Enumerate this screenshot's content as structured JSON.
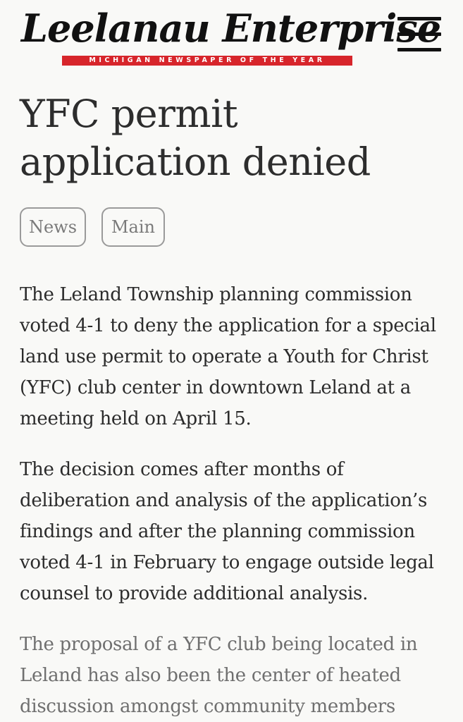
{
  "masthead": {
    "title": "Leelanau Enterprise",
    "tagline": "MICHIGAN NEWSPAPER OF THE YEAR",
    "menu_icon": "hamburger-menu-icon",
    "colors": {
      "tagline_bg": "#d7252b",
      "title": "#111111"
    }
  },
  "article": {
    "title_line1": "YFC permit",
    "title_line2": "application denied",
    "tags": [
      "News",
      "Main"
    ],
    "paragraphs": [
      "The Leland Township planning commission voted 4-1 to deny the application for a special land use permit to operate a Youth for Christ (YFC) club center in downtown Leland at a meeting held on April 15.",
      "The decision comes after months of deliberation and analysis of the application’s findings and after the planning commission voted 4-1 in February to engage outside legal counsel to provide additional analysis.",
      "The proposal of a YFC club being located in Leland has also been the center of heated discussion amongst community members"
    ]
  }
}
